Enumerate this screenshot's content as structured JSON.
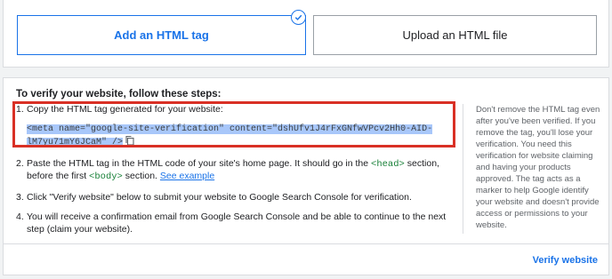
{
  "methods": {
    "html_tag_label": "Add an HTML tag",
    "upload_label": "Upload an HTML file"
  },
  "main": {
    "title": "To verify your website, follow these steps:",
    "step1_num": "1.",
    "step1_text": "Copy the HTML tag generated for your website:",
    "code_line1": "<meta name=\"google-site-verification\" content=\"dshUfv1J4rFxGNfwVPcv2Hh0-AID-",
    "code_line2": "lM7yu71mY6JCaM\" />",
    "step2_num": "2.",
    "step2_a": "Paste the HTML tag in the HTML code of your site's home page. It should go in the ",
    "step2_head": "<head>",
    "step2_b": " section, before the first ",
    "step2_body": "<body>",
    "step2_c": " section. ",
    "step2_link": "See example",
    "step3_num": "3.",
    "step3_text": "Click \"Verify website\" below to submit your website to Google Search Console for verification.",
    "step4_num": "4.",
    "step4_text": "You will receive a confirmation email from Google Search Console and be able to continue to the next step (claim your website).",
    "side_note": "Don't remove the HTML tag even after you've been verified. If you remove the tag, you'll lose your verification. You need this verification for website claiming and having your products approved. The tag acts as a marker to help Google identify your website and doesn't provide access or permissions to your website.",
    "verify_label": "Verify website"
  },
  "icons": {
    "selected": "check-circle-icon",
    "copy": "copy-icon"
  },
  "colors": {
    "accent": "#1a73e8",
    "highlight_box": "#d93025",
    "code_tag": "#188038"
  }
}
